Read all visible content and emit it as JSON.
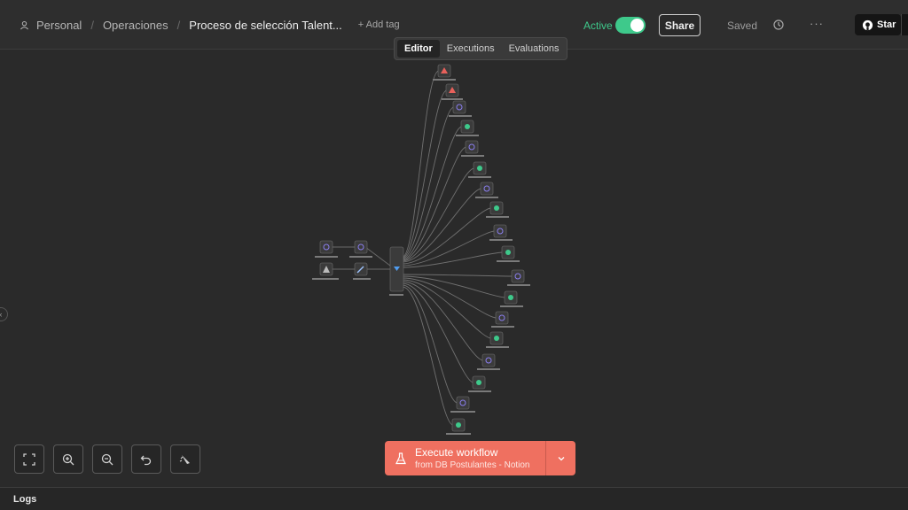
{
  "breadcrumb": {
    "workspace": "Personal",
    "folder": "Operaciones",
    "workflow_name": "Proceso de selección Talent...",
    "add_tag": "+ Add tag"
  },
  "header": {
    "status_label": "Active",
    "status_on": true,
    "share_label": "Share",
    "saved_label": "Saved",
    "more_label": "···",
    "star_label": "Star"
  },
  "tabs": [
    {
      "label": "Editor",
      "selected": true
    },
    {
      "label": "Executions",
      "selected": false
    },
    {
      "label": "Evaluations",
      "selected": false
    }
  ],
  "canvas_controls": [
    "fit-view-icon",
    "zoom-in-icon",
    "zoom-out-icon",
    "undo-icon",
    "tidy-up-icon"
  ],
  "execute": {
    "title": "Execute workflow",
    "subtitle": "from DB Postulantes - Notion"
  },
  "logs_label": "Logs",
  "colors": {
    "accent": "#3ec98b",
    "execute_bg": "#ef7060",
    "canvas_bg": "#2a2a2a",
    "node_bg": "#3b3b3b",
    "node_error": "#e8615b",
    "node_notion": "#4f9cf0",
    "node_purple": "#8b7ff0",
    "node_green": "#3ec98b"
  }
}
